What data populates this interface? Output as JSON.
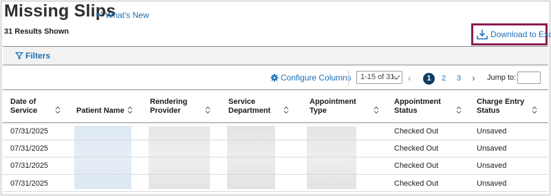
{
  "page": {
    "title": "Missing Slips",
    "whats_new_label": "What's New",
    "results_label": "31 Results Shown",
    "download_label": "Download to Excel",
    "filters_label": "Filters",
    "configure_columns_label": "Configure Columns"
  },
  "pagination": {
    "range": "1-15 of 31",
    "pages": [
      "1",
      "2",
      "3"
    ],
    "current_page": "1",
    "jump_label": "Jump to:",
    "jump_value": ""
  },
  "table": {
    "columns": [
      "Date of Service",
      "Patient Name",
      "Rendering Provider",
      "Service Department",
      "Appointment Type",
      "Appointment Status",
      "Charge Entry Status"
    ],
    "rows": [
      {
        "date": "07/31/2025",
        "appt_status": "Checked Out",
        "charge_status": "Unsaved"
      },
      {
        "date": "07/31/2025",
        "appt_status": "Checked Out",
        "charge_status": "Unsaved"
      },
      {
        "date": "07/31/2025",
        "appt_status": "Checked Out",
        "charge_status": "Unsaved"
      },
      {
        "date": "07/31/2025",
        "appt_status": "Checked Out",
        "charge_status": "Unsaved"
      }
    ]
  },
  "colors": {
    "link": "#1b6fb5",
    "highlight_border": "#8a1b4e",
    "current_page_bg": "#0f3d61"
  }
}
